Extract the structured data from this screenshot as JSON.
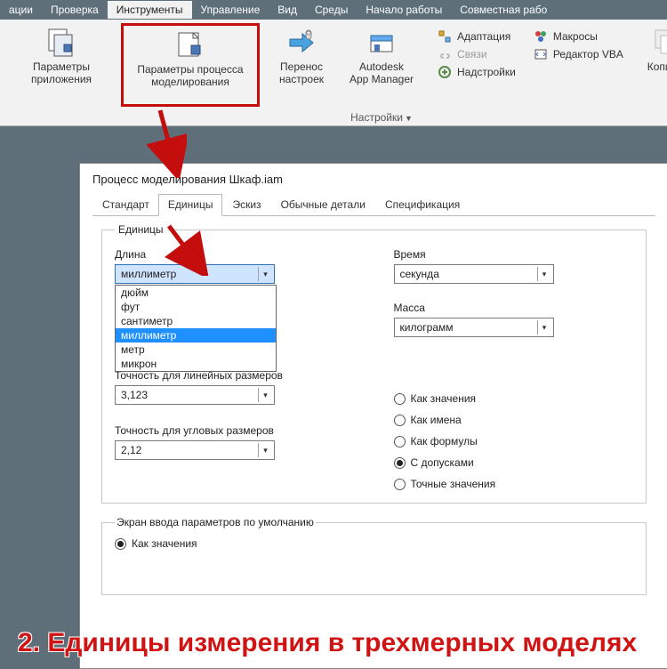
{
  "tabs": {
    "t0": "ации",
    "t1": "Проверка",
    "t2": "Инструменты",
    "t3": "Управление",
    "t4": "Вид",
    "t5": "Среды",
    "t6": "Начало работы",
    "t7": "Совместная рабо"
  },
  "ribbon": {
    "appParams": "Параметры приложения",
    "procParams": "Параметры процесса моделирования",
    "migrate": "Перенос настроек",
    "appMgr1": "Autodesk",
    "appMgr2": "App Manager",
    "settingsCaption": "Настройки",
    "adapt": "Адаптация",
    "links": "Связи",
    "addins": "Надстройки",
    "macros": "Макросы",
    "vba": "Редактор VBA",
    "copy": "Копиро"
  },
  "dialog": {
    "title": "Процесс моделирования Шкаф.iam",
    "tabs": {
      "std": "Стандарт",
      "units": "Единицы",
      "sketch": "Эскиз",
      "common": "Обычные детали",
      "bom": "Спецификация"
    },
    "unitsLegend": "Единицы",
    "lengthLabel": "Длина",
    "timeLabel": "Время",
    "massLabel": "Масса",
    "lengthValue": "миллиметр",
    "timeValue": "секунда",
    "massValue": "килограмм",
    "lengthOptions": {
      "o0": "дюйм",
      "o1": "фут",
      "o2": "сантиметр",
      "o3": "миллиметр",
      "o4": "метр",
      "o5": "микрон"
    },
    "precLinear": "Точность для линейных размеров",
    "precLinearVal": "3,123",
    "precAngular": "Точность для угловых размеров",
    "precAngularVal": "2,12",
    "radios": {
      "r0": "Как значения",
      "r1": "Как имена",
      "r2": "Как формулы",
      "r3": "С допусками",
      "r4": "Точные значения"
    },
    "defLegend": "Экран ввода параметров по умолчанию",
    "defRadio": "Как значения"
  },
  "overlay": "2. Единицы измерения в трехмерных моделях"
}
